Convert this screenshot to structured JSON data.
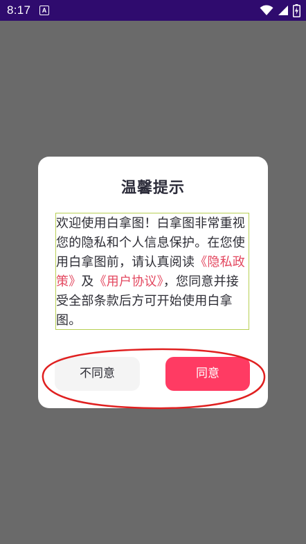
{
  "status_bar": {
    "time": "8:17",
    "notification_badge": "A",
    "icons": [
      "wifi-icon",
      "signal-icon",
      "battery-icon"
    ]
  },
  "dialog": {
    "title": "温馨提示",
    "body": {
      "text_before": "欢迎使用白拿图！白拿图非常重视您的隐私和个人信息保护。在您使用白拿图前，请认真阅读",
      "privacy_link": "《隐私政策》",
      "conjunction": "及",
      "agreement_link": "《用户协议》",
      "text_after": "，您同意并接受全部条款后方可开始使用白拿图。"
    },
    "disagree_label": "不同意",
    "agree_label": "同意"
  },
  "colors": {
    "status_bar": "#2f0b6e",
    "overlay": "#6a6a6a",
    "link": "#e3475f",
    "agree_button": "#ff3b63",
    "disagree_button": "#f4f4f4",
    "body_border": "#b7cf52",
    "annotation": "#e02020"
  }
}
